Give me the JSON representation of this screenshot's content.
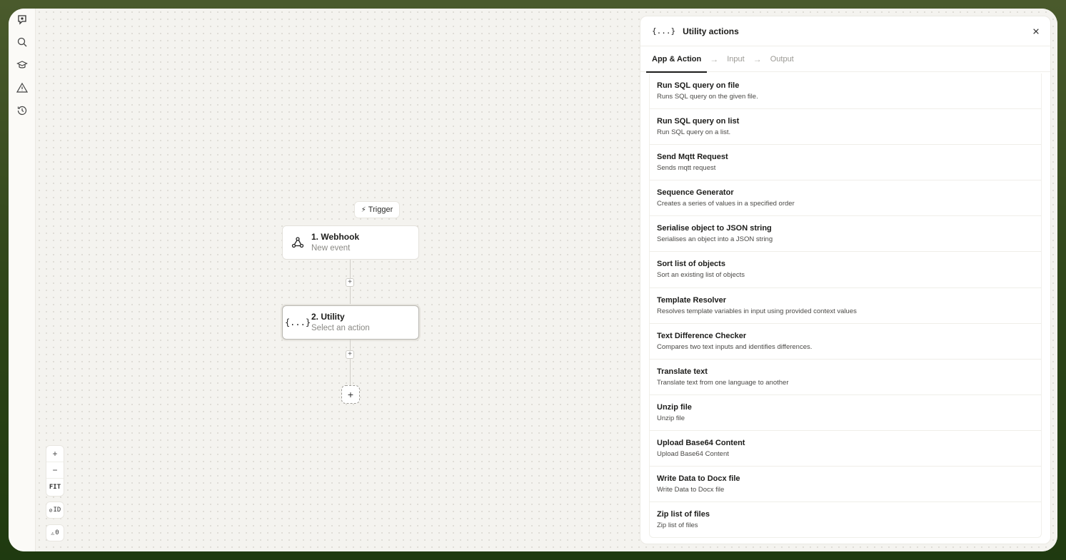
{
  "canvas": {
    "trigger_chip": "Trigger",
    "nodes": [
      {
        "title": "1. Webhook",
        "subtitle": "New event",
        "icon": "webhook-icon"
      },
      {
        "title": "2. Utility",
        "subtitle": "Select an action",
        "icon": "braces-icon",
        "icon_text": "{...}"
      }
    ],
    "add_step": "+",
    "mini_plus": "+"
  },
  "controls": {
    "zoom_in": "+",
    "zoom_out": "−",
    "fit": "FIT",
    "id_label": "ID",
    "warnings_count": "0"
  },
  "panel": {
    "icon_text": "{...}",
    "title": "Utility actions",
    "tabs": [
      {
        "label": "App & Action",
        "active": true
      },
      {
        "label": "Input",
        "active": false
      },
      {
        "label": "Output",
        "active": false
      }
    ],
    "tab_arrow": "→",
    "items": [
      {
        "title": "Run SQL query on file",
        "desc": "Runs SQL query on the given file."
      },
      {
        "title": "Run SQL query on list",
        "desc": "Run SQL query on a list."
      },
      {
        "title": "Send Mqtt Request",
        "desc": "Sends mqtt request"
      },
      {
        "title": "Sequence Generator",
        "desc": "Creates a series of values in a specified order"
      },
      {
        "title": "Serialise object to JSON string",
        "desc": "Serialises an object into a JSON string"
      },
      {
        "title": "Sort list of objects",
        "desc": "Sort an existing list of objects"
      },
      {
        "title": "Template Resolver",
        "desc": "Resolves template variables in input using provided context values"
      },
      {
        "title": "Text Difference Checker",
        "desc": "Compares two text inputs and identifies differences."
      },
      {
        "title": "Translate text",
        "desc": "Translate text from one language to another"
      },
      {
        "title": "Unzip file",
        "desc": "Unzip file"
      },
      {
        "title": "Upload Base64 Content",
        "desc": "Upload Base64 Content"
      },
      {
        "title": "Write Data to Docx file",
        "desc": "Write Data to Docx file"
      },
      {
        "title": "Zip list of files",
        "desc": "Zip list of files"
      }
    ]
  },
  "sidebar": {
    "icons": [
      "logo-icon",
      "search-icon",
      "graduation-cap-icon",
      "warning-icon",
      "history-icon"
    ]
  },
  "colors": {
    "bezel_top": "#4a5a2c",
    "bezel_bottom": "#1f3a10",
    "canvas_bg": "#f4f3ef",
    "panel_bg": "#ffffff",
    "text_primary": "#1c1c1a",
    "text_muted": "#8a8984"
  }
}
